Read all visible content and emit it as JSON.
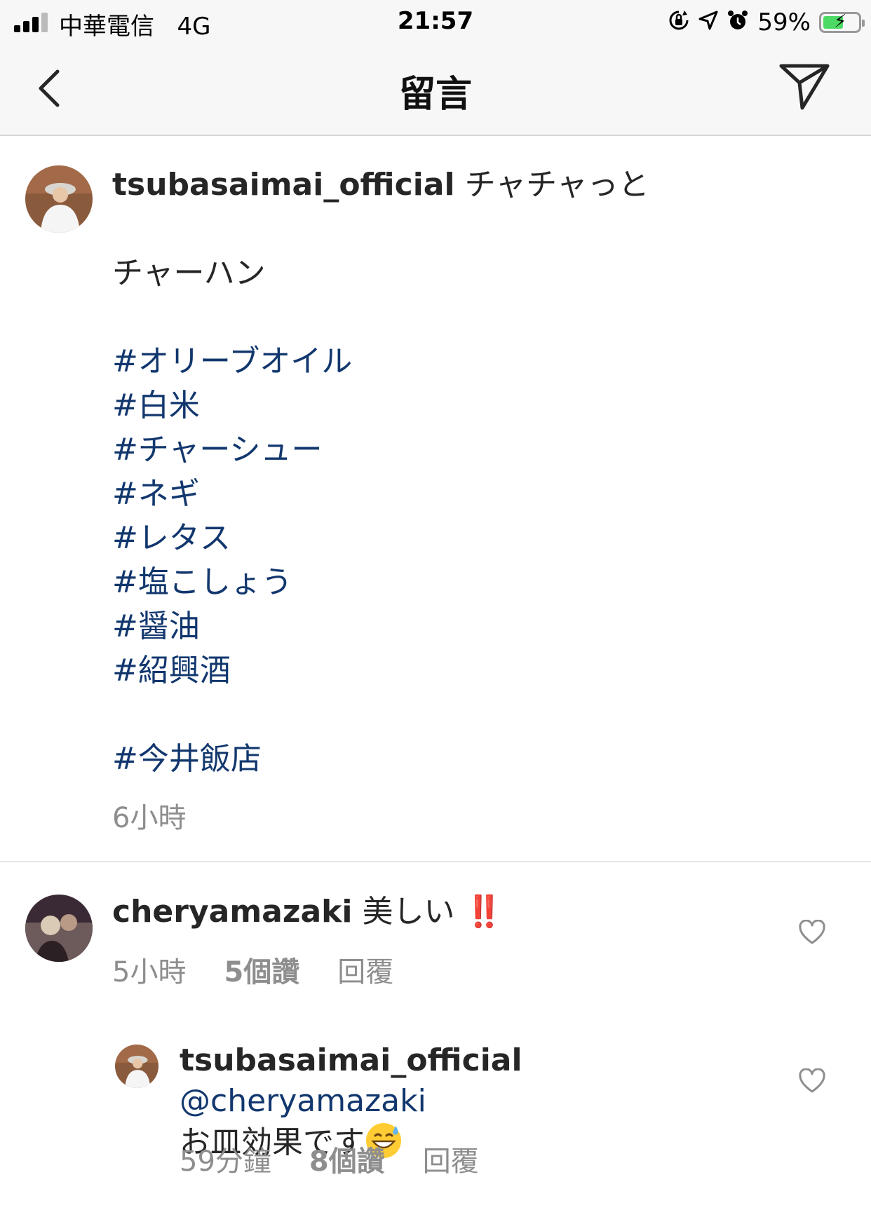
{
  "status_bar": {
    "carrier": "中華電信",
    "network": "4G",
    "time": "21:57",
    "battery": "59%",
    "icons": [
      "orientation-lock-icon",
      "location-arrow-icon",
      "alarm-icon",
      "battery-charging-icon"
    ],
    "battery_level": 0.59
  },
  "nav": {
    "title": "留言",
    "back_icon": "chevron-left-icon",
    "share_icon": "paper-plane-icon"
  },
  "caption": {
    "username": "tsubasaimai_official",
    "first_line": "チャチャっと",
    "second_line": "チャーハン",
    "hashtags": [
      "#オリーブオイル",
      "#白米",
      "#チャーシュー",
      "#ネギ",
      "#レタス",
      "#塩こしょう",
      "#醤油",
      "#紹興酒"
    ],
    "last_hashtag": "#今井飯店",
    "time": "6小時"
  },
  "comments": [
    {
      "username": "cheryamazaki",
      "text": "美しい",
      "emoji": "‼️",
      "time": "5小時",
      "likes": "5個讚",
      "reply": "回覆"
    }
  ],
  "replies": [
    {
      "username": "tsubasaimai_official",
      "mention": "@cheryamazaki",
      "text": "お皿効果です",
      "emoji": "grinning-sweat-emoji",
      "time": "59分鐘",
      "likes": "8個讚",
      "reply": "回覆"
    }
  ],
  "colors": {
    "hashtag": "#12376e",
    "meta": "#8e8e8e",
    "bar_bg": "#f7f7f7",
    "battery_fill": "#4cd964"
  }
}
